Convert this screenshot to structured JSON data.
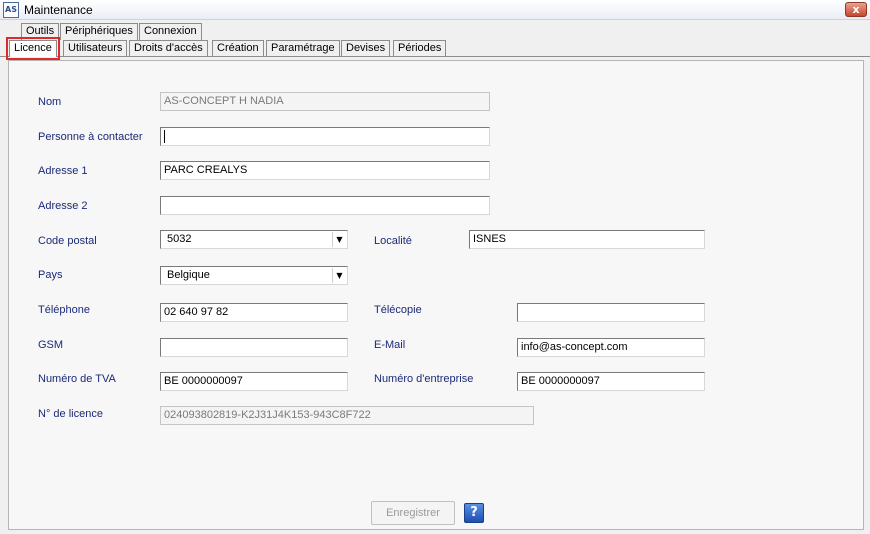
{
  "window": {
    "title": "Maintenance",
    "app_icon": "AS",
    "close_glyph": "x"
  },
  "top_tabs": [
    "Outils",
    "Périphériques",
    "Connexion"
  ],
  "sub_tabs": [
    "Licence",
    "Utilisateurs",
    "Droits d'accès",
    "Création",
    "Paramétrage",
    "Devises",
    "Périodes"
  ],
  "active_tab": "Licence",
  "form": {
    "nom": {
      "label": "Nom",
      "value": "AS-CONCEPT H NADIA"
    },
    "contact": {
      "label": "Personne à contacter",
      "value": ""
    },
    "adresse1": {
      "label": "Adresse 1",
      "value": "PARC CREALYS"
    },
    "adresse2": {
      "label": "Adresse 2",
      "value": ""
    },
    "code_postal": {
      "label": "Code postal",
      "value": "5032"
    },
    "localite": {
      "label": "Localité",
      "value": "ISNES"
    },
    "pays": {
      "label": "Pays",
      "value": "Belgique"
    },
    "telephone": {
      "label": "Téléphone",
      "value": "02 640 97 82"
    },
    "telecopie": {
      "label": "Télécopie",
      "value": ""
    },
    "gsm": {
      "label": "GSM",
      "value": ""
    },
    "email": {
      "label": "E-Mail",
      "value": "info@as-concept.com"
    },
    "tva": {
      "label": "Numéro de TVA",
      "value": "BE 0000000097"
    },
    "entreprise": {
      "label": "Numéro  d'entreprise",
      "value": "BE 0000000097"
    },
    "licence": {
      "label": "N° de licence",
      "value": "024093802819-K2J31J4K153-943C8F722"
    }
  },
  "buttons": {
    "save": "Enregistrer",
    "help": "?"
  },
  "icons": {
    "combo": "dropdown-arrow-icon",
    "help": "help-icon",
    "close": "close-icon",
    "app": "app-logo-icon"
  },
  "colors": {
    "label_text": "#1c2a78",
    "active_tab_outline": "#e02a2a",
    "help_button": "#1c4fb3",
    "close_button": "#c9462c"
  }
}
